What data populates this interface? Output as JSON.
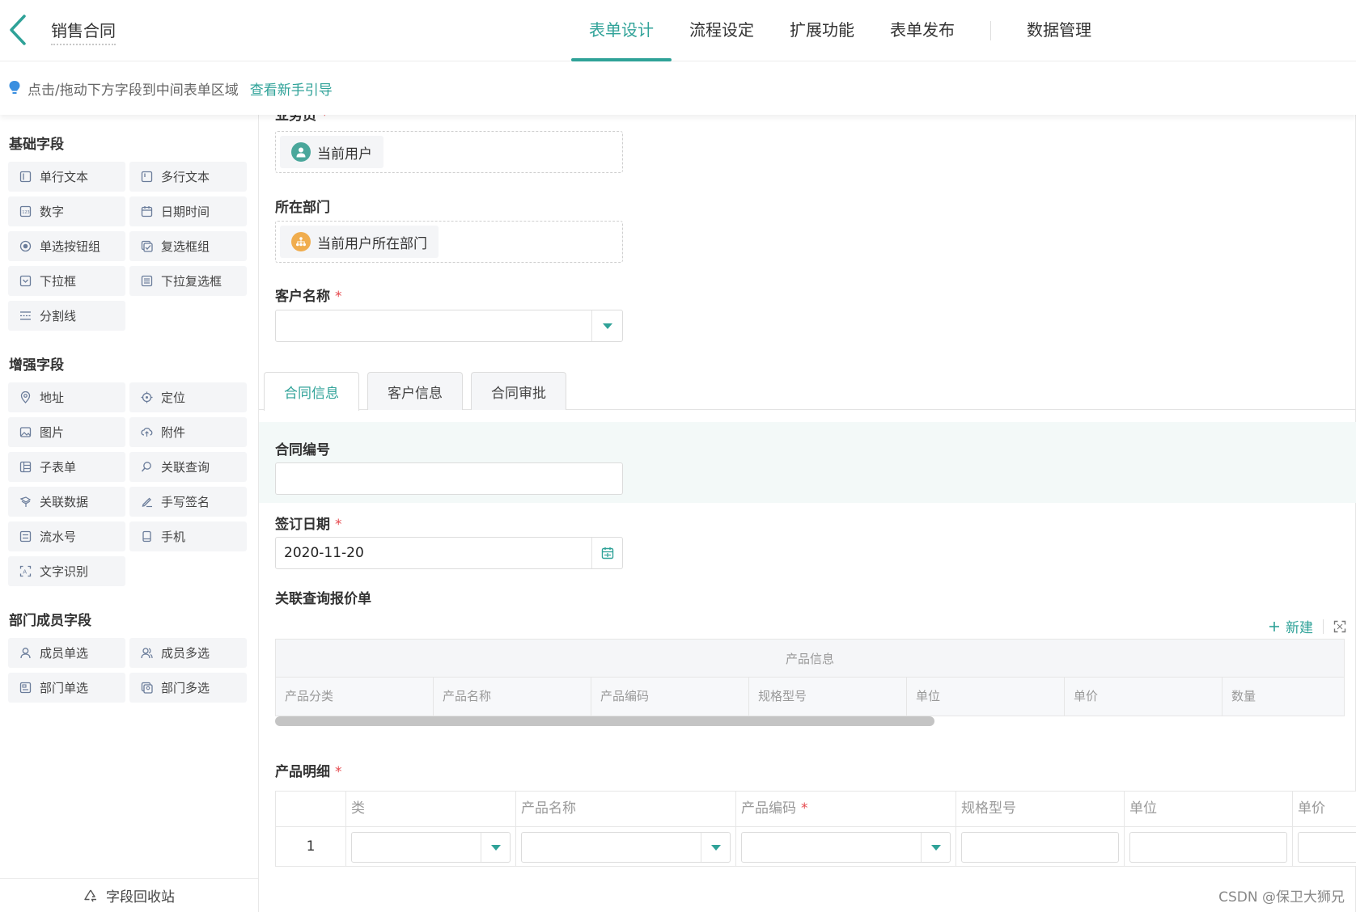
{
  "header": {
    "title": "销售合同",
    "nav": [
      "表单设计",
      "流程设定",
      "扩展功能",
      "表单发布",
      "数据管理"
    ],
    "active_nav": "表单设计"
  },
  "hint": {
    "text": "点击/拖动下方字段到中间表单区域",
    "link": "查看新手引导"
  },
  "sidebar": {
    "groups": [
      {
        "title": "基础字段",
        "items": [
          {
            "label": "单行文本",
            "icon": "single-line-icon"
          },
          {
            "label": "多行文本",
            "icon": "multi-line-icon"
          },
          {
            "label": "数字",
            "icon": "number-icon"
          },
          {
            "label": "日期时间",
            "icon": "calendar-icon"
          },
          {
            "label": "单选按钮组",
            "icon": "radio-icon"
          },
          {
            "label": "复选框组",
            "icon": "checkbox-icon"
          },
          {
            "label": "下拉框",
            "icon": "dropdown-icon"
          },
          {
            "label": "下拉复选框",
            "icon": "dropdown-multi-icon"
          },
          {
            "label": "分割线",
            "icon": "divider-icon"
          }
        ]
      },
      {
        "title": "增强字段",
        "items": [
          {
            "label": "地址",
            "icon": "address-icon"
          },
          {
            "label": "定位",
            "icon": "location-icon"
          },
          {
            "label": "图片",
            "icon": "image-icon"
          },
          {
            "label": "附件",
            "icon": "attachment-icon"
          },
          {
            "label": "子表单",
            "icon": "subform-icon"
          },
          {
            "label": "关联查询",
            "icon": "link-query-icon"
          },
          {
            "label": "关联数据",
            "icon": "link-data-icon"
          },
          {
            "label": "手写签名",
            "icon": "signature-icon"
          },
          {
            "label": "流水号",
            "icon": "serial-icon"
          },
          {
            "label": "手机",
            "icon": "phone-icon"
          },
          {
            "label": "文字识别",
            "icon": "ocr-icon"
          }
        ]
      },
      {
        "title": "部门成员字段",
        "items": [
          {
            "label": "成员单选",
            "icon": "member-single-icon"
          },
          {
            "label": "成员多选",
            "icon": "member-multi-icon"
          },
          {
            "label": "部门单选",
            "icon": "dept-single-icon"
          },
          {
            "label": "部门多选",
            "icon": "dept-multi-icon"
          }
        ]
      }
    ],
    "recycle": "字段回收站"
  },
  "form": {
    "salesperson_label": "业务员",
    "salesperson_value": "当前用户",
    "dept_label": "所在部门",
    "dept_value": "当前用户所在部门",
    "customer_label": "客户名称",
    "tabs": [
      "合同信息",
      "客户信息",
      "合同审批"
    ],
    "active_tab": "合同信息",
    "contract_no_label": "合同编号",
    "sign_date_label": "签订日期",
    "sign_date_value": "2020-11-20",
    "related_label": "关联查询报价单",
    "new_label": "新建",
    "related_group_header": "产品信息",
    "related_columns": [
      "产品分类",
      "产品名称",
      "产品编码",
      "规格型号",
      "单位",
      "单价",
      "数量"
    ],
    "detail_label": "产品明细",
    "detail_columns": [
      "类",
      "产品名称",
      "产品编码",
      "规格型号",
      "单位",
      "单价"
    ],
    "detail_row_index": "1",
    "required_mark": "*"
  },
  "watermark": "CSDN @保卫大狮兄",
  "colors": {
    "accent": "#2fa298",
    "required": "#e5484d",
    "user_chip": "#4aa79b",
    "dept_chip": "#f0ad4e"
  }
}
